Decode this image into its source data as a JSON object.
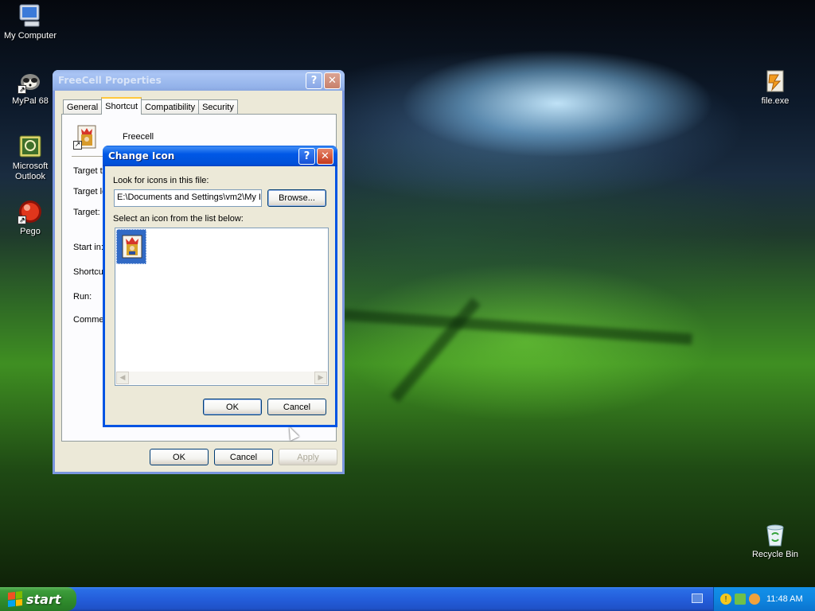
{
  "desktop": {
    "icons": [
      {
        "label": "My Computer",
        "icon": "computer-icon"
      },
      {
        "label": "MyPal 68",
        "icon": "raccoon-browser-icon"
      },
      {
        "label": "Microsoft Outlook",
        "icon": "outlook-icon"
      },
      {
        "label": "Pego",
        "icon": "red-ball-icon"
      },
      {
        "label": "file.exe",
        "icon": "exe-file-icon"
      },
      {
        "label": "Recycle Bin",
        "icon": "recycle-bin-icon"
      }
    ]
  },
  "properties_window": {
    "title": "FreeCell Properties",
    "help_glyph": "?",
    "close_glyph": "✕",
    "tabs": [
      "General",
      "Shortcut",
      "Compatibility",
      "Security"
    ],
    "selected_tab": "Shortcut",
    "shortcut_name": "Freecell",
    "field_labels": [
      "Target t",
      "Target lo",
      "Target:",
      "Start in:",
      "Shortcu",
      "Run:",
      "Commer"
    ],
    "buttons": {
      "ok": "OK",
      "cancel": "Cancel",
      "apply": "Apply"
    }
  },
  "change_icon_dialog": {
    "title": "Change Icon",
    "help_glyph": "?",
    "close_glyph": "✕",
    "look_label": "Look for icons in this file:",
    "file_path": "E:\\Documents and Settings\\vm2\\My I",
    "browse_label": "Browse...",
    "select_label": "Select an icon from the list below:",
    "icons": [
      "freecell-king-icon"
    ],
    "scroll_left": "◀",
    "scroll_right": "▶",
    "buttons": {
      "ok": "OK",
      "cancel": "Cancel"
    }
  },
  "taskbar": {
    "start_label": "start",
    "clock": "11:48 AM"
  },
  "colors": {
    "title_active": "#0054e3",
    "title_inactive": "#7a96df",
    "window_face": "#ece9d8",
    "taskbar": "#245edb",
    "start_green": "#3c9c3a"
  }
}
